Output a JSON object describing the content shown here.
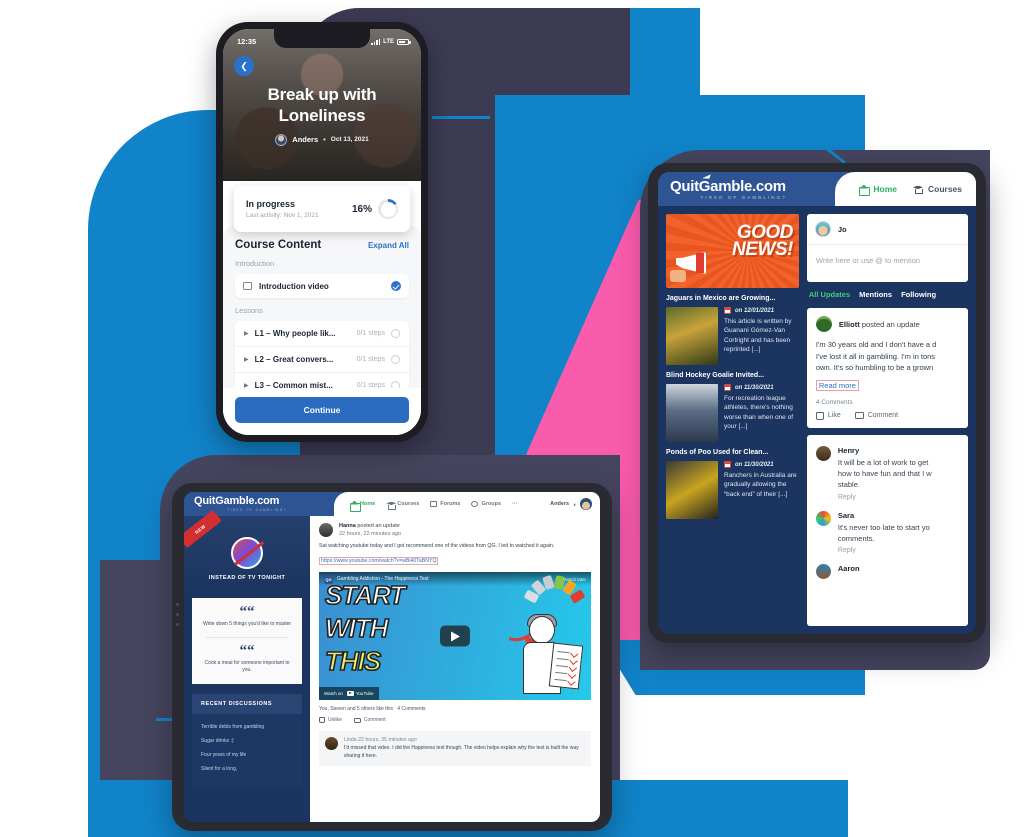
{
  "phone": {
    "status": {
      "time": "12:35",
      "network": "LTE"
    },
    "back_icon": "chevron-left-icon",
    "hero": {
      "title_line1": "Break up with",
      "title_line2": "Loneliness",
      "author": "Anders",
      "separator": "•",
      "date": "Oct 13, 2021"
    },
    "progress": {
      "status": "In progress",
      "last_activity": "Last activity: Nov 1, 2021",
      "percent_label": "16%",
      "percent_value": 16
    },
    "course": {
      "heading": "Course Content",
      "expand_all": "Expand All",
      "intro_label": "Introduction",
      "intro_item": "Introduction video",
      "lessons_label": "Lessons",
      "lessons": [
        {
          "name": "L1 – Why people lik...",
          "steps": "0/1 steps"
        },
        {
          "name": "L2 – Great convers...",
          "steps": "0/1 steps"
        },
        {
          "name": "L3 – Common mist...",
          "steps": "0/1 steps"
        }
      ],
      "continue": "Continue"
    }
  },
  "tablet_right": {
    "brand": {
      "name_part1": "Quit",
      "name_part2": "G",
      "name_part3": "amble.com",
      "tagline": "TIRED OF GAMBLING?"
    },
    "nav": [
      {
        "label": "Home",
        "icon": "home-icon",
        "active": true
      },
      {
        "label": "Courses",
        "icon": "graduation-cap-icon",
        "active": false
      }
    ],
    "banner": {
      "line1": "GOOD",
      "line2": "NEWS!"
    },
    "news": [
      {
        "title": "Jaguars in Mexico are Growing...",
        "date": "on 12/01/2021",
        "excerpt": "This article is written by Guananí Gómez-Van Cortright and has been reprinted [...]"
      },
      {
        "title": "Blind Hockey Goalie Invited...",
        "date": "on 11/30/2021",
        "excerpt": "For recreation league athletes, there's nothing worse than when one of your [...]"
      },
      {
        "title": "Ponds of Poo Used for Clean...",
        "date": "on 11/30/2021",
        "excerpt": "Ranchers in Australia are gradually allowing the “back end” of their [...]"
      }
    ],
    "composer": {
      "user": "Jo",
      "placeholder": "Write here or use @ to mention"
    },
    "feed_tabs": [
      {
        "label": "All Updates",
        "active": true
      },
      {
        "label": "Mentions",
        "active": false
      },
      {
        "label": "Following",
        "active": false
      }
    ],
    "post": {
      "author": "Elliott",
      "action": "posted an update",
      "body_line1": "I'm 30 years old and I don't have a d",
      "body_line2": "I've lost it all in gambling. I'm in tons",
      "body_line3": "own. It's so humbling to be a grown",
      "read_more": "Read more",
      "comments_count": "4 Comments",
      "like": "Like",
      "comment": "Comment"
    },
    "comments": [
      {
        "name": "Henry",
        "line1": "It will be a lot of work to get",
        "line2": "how to have fun and that I w",
        "line3": "stable.",
        "reply": "Reply"
      },
      {
        "name": "Sara",
        "line1": "It's never too late to start yo",
        "line2": "comments.",
        "line3": "",
        "reply": "Reply"
      },
      {
        "name": "Aaron",
        "line1": "",
        "line2": "",
        "line3": "",
        "reply": ""
      }
    ]
  },
  "tablet_bottom": {
    "brand": {
      "name_part1": "Quit",
      "name_part2": "G",
      "name_part3": "amble.com",
      "tagline": "TIRED OF GAMBLING?"
    },
    "nav": [
      {
        "label": "Home",
        "icon": "home-icon",
        "active": true
      },
      {
        "label": "Courses",
        "icon": "graduation-cap-icon",
        "active": false
      },
      {
        "label": "Forums",
        "icon": "forum-icon",
        "active": false
      },
      {
        "label": "Groups",
        "icon": "groups-icon",
        "active": false
      },
      {
        "label": "···",
        "icon": "more-icon",
        "active": false
      }
    ],
    "user": {
      "name": "Anders",
      "caret": "∨"
    },
    "sidebar": {
      "ribbon": "NEW",
      "promo_title": "INSTEAD OF TV TONIGHT",
      "quotes": [
        "Write down 5 things you'd like to master",
        "Cook a meal for someone important to you."
      ],
      "discussions_title": "RECENT DISCUSSIONS",
      "discussions": [
        "Terrible debts from gambling",
        "Sugar drinks :)",
        "Four years of my life",
        "Silent for a long,"
      ]
    },
    "post": {
      "author": "Hanna",
      "action": "posted an update",
      "time": "22 hours, 22 minutes ago",
      "text": "Sat watching youtube today and I got recommend one of the videos from QG. I led to watched it again.",
      "link": "https://www.youtube.com/watch?v=wBi40TaBNYQ",
      "video": {
        "channel_badge": "QG",
        "title": "Gambling Addiction - The Happiness Test",
        "watch_later": "Watch later",
        "text_line1": "START",
        "text_line2": "WITH",
        "text_line3": "THIS",
        "watch_on": "Watch on",
        "platform": "YouTube"
      },
      "likes": "You, Steven and 5 others like this",
      "comments_count": "4 Comments",
      "unlike": "Unlike",
      "comment": "Comment"
    },
    "comment": {
      "name": "Linda",
      "time": "22 hours, 35 minutes ago",
      "text": "I'd missed that video. I did the Happiness test though. The video helps explain why the test is built the way sharing it here."
    }
  },
  "colors": {
    "blue": "#1183c9",
    "pink": "#f95bad",
    "dark": "#46455f",
    "brand_blue": "#2e5493",
    "accent_green": "#2fae60",
    "phone_blue": "#2a6dc0"
  }
}
